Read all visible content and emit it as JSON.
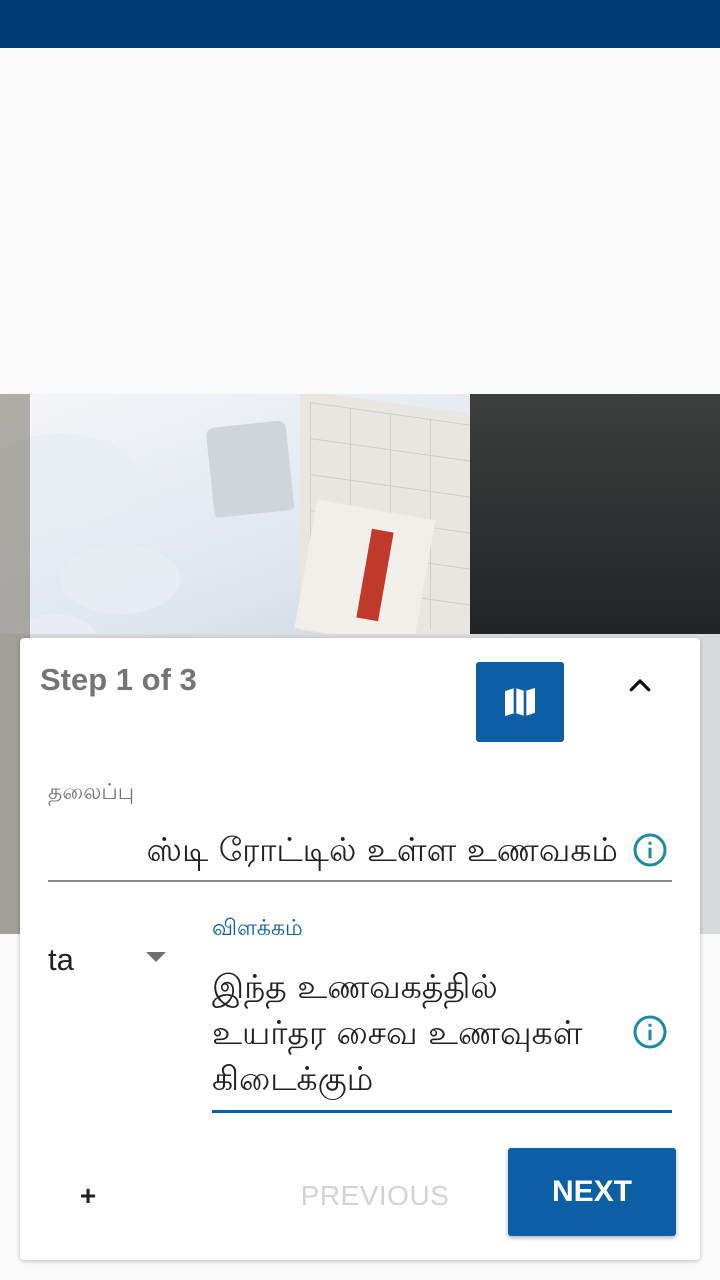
{
  "colors": {
    "status_bar": "#003a73",
    "accent": "#0d5fa5",
    "card_bg": "#ffffff",
    "page_bg": "#fafafa"
  },
  "card": {
    "step_title": "Step 1 of 3",
    "map_icon": "map-icon",
    "collapse_icon": "chevron-up-icon"
  },
  "form": {
    "title_label": "தலைப்பு",
    "title_value": "ஸ்டி ரோட்டில் உள்ள உணவகம்",
    "language_value": "ta",
    "description_label": "விளக்கம்",
    "description_value": "இந்த உணவகத்தில் உயர்தர சைவ உணவுகள் கிடைக்கும்",
    "info_icon": "info-icon"
  },
  "actions": {
    "add_label": "+",
    "previous_label": "PREVIOUS",
    "next_label": "NEXT"
  }
}
